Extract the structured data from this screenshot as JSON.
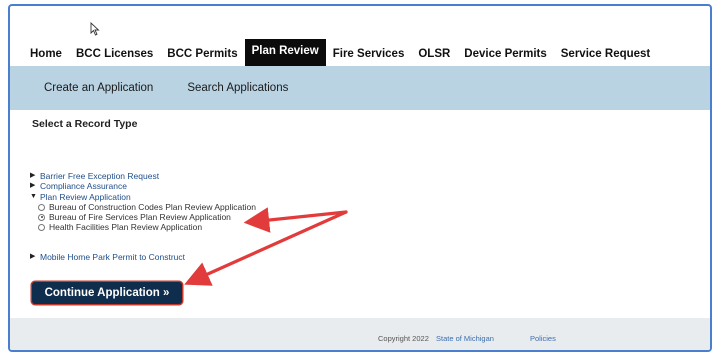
{
  "nav": {
    "items": [
      {
        "label": "Home"
      },
      {
        "label": "BCC Licenses"
      },
      {
        "label": "BCC Permits"
      },
      {
        "label": "Plan Review"
      },
      {
        "label": "Fire Services"
      },
      {
        "label": "OLSR"
      },
      {
        "label": "Device Permits"
      },
      {
        "label": "Service Request"
      }
    ],
    "active": "Plan Review"
  },
  "subnav": {
    "items": [
      {
        "label": "Create an Application"
      },
      {
        "label": "Search Applications"
      }
    ]
  },
  "main": {
    "title": "Select a Record Type",
    "records": [
      {
        "label": "Barrier Free Exception Request",
        "icon": "triangle-right"
      },
      {
        "label": "Compliance Assurance",
        "icon": "triangle-right"
      },
      {
        "label": "Plan Review Application",
        "icon": "triangle-down"
      }
    ],
    "plan_review_options": [
      {
        "label": "Bureau of Construction Codes Plan Review Application",
        "selected": false
      },
      {
        "label": "Bureau of Fire Services Plan Review Application",
        "selected": true
      },
      {
        "label": "Health Facilities Plan Review Application",
        "selected": false
      }
    ],
    "mobile_home": "Mobile Home Park Permit to Construct",
    "continue_button": "Continue Application »"
  },
  "footer": {
    "copyright": "Copyright 2022",
    "state_link": "State of Michigan",
    "policies_link": "Policies"
  },
  "colors": {
    "nav_active_bg": "#0b0b0b",
    "subnav_bg": "#b9d3e3",
    "button_bg": "#0f2d4c",
    "annotation_arrow": "#e23b3b",
    "frame_border": "#4a7fd0"
  }
}
